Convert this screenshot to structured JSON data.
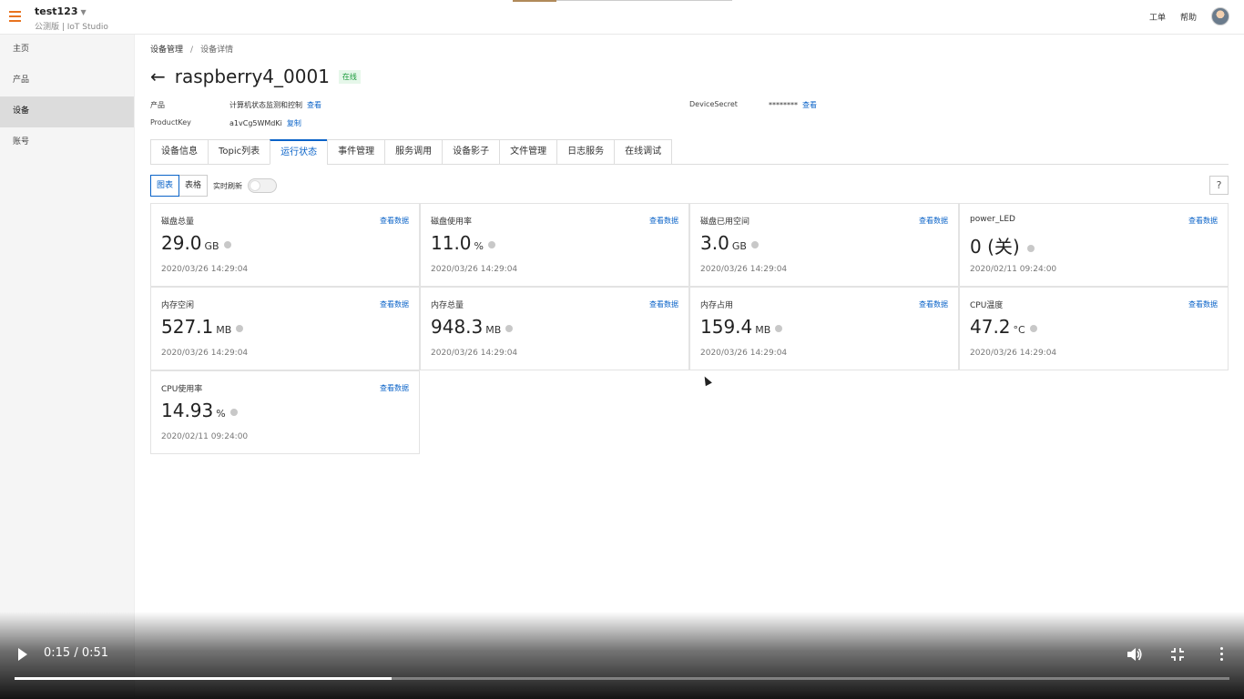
{
  "header": {
    "account": "test123",
    "subtitle": "公测版 | IoT Studio",
    "links": [
      "工单",
      "帮助"
    ]
  },
  "sidebar": {
    "items": [
      {
        "label": "主页"
      },
      {
        "label": "产品"
      },
      {
        "label": "设备"
      },
      {
        "label": "账号"
      }
    ],
    "active_index": 2
  },
  "breadcrumb": {
    "parent": "设备管理",
    "separator": "/",
    "current": "设备详情"
  },
  "device": {
    "name": "raspberry4_0001",
    "status": "在线",
    "product_label": "产品",
    "product_value": "计算机状态监测和控制",
    "product_link": "查看",
    "productkey_label": "ProductKey",
    "productkey_value": "a1vCg5WMdKi",
    "productkey_link": "复制",
    "secret_label": "DeviceSecret",
    "secret_value": "********",
    "secret_link": "查看"
  },
  "tabs": [
    "设备信息",
    "Topic列表",
    "运行状态",
    "事件管理",
    "服务调用",
    "设备影子",
    "文件管理",
    "日志服务",
    "在线调试"
  ],
  "active_tab": 2,
  "toolbar": {
    "view_chart": "图表",
    "view_table": "表格",
    "realtime_label": "实时刷新",
    "realtime_on": false,
    "help": "?"
  },
  "cards": [
    {
      "name": "磁盘总量",
      "value": "29.0",
      "unit": "GB",
      "time": "2020/03/26 14:29:04",
      "link": "查看数据"
    },
    {
      "name": "磁盘使用率",
      "value": "11.0",
      "unit": "%",
      "time": "2020/03/26 14:29:04",
      "link": "查看数据"
    },
    {
      "name": "磁盘已用空间",
      "value": "3.0",
      "unit": "GB",
      "time": "2020/03/26 14:29:04",
      "link": "查看数据"
    },
    {
      "name": "power_LED",
      "value": "0 (关)",
      "unit": "",
      "time": "2020/02/11 09:24:00",
      "link": "查看数据"
    },
    {
      "name": "内存空闲",
      "value": "527.1",
      "unit": "MB",
      "time": "2020/03/26 14:29:04",
      "link": "查看数据"
    },
    {
      "name": "内存总量",
      "value": "948.3",
      "unit": "MB",
      "time": "2020/03/26 14:29:04",
      "link": "查看数据"
    },
    {
      "name": "内存占用",
      "value": "159.4",
      "unit": "MB",
      "time": "2020/03/26 14:29:04",
      "link": "查看数据"
    },
    {
      "name": "CPU温度",
      "value": "47.2",
      "unit": "°C",
      "time": "2020/03/26 14:29:04",
      "link": "查看数据"
    },
    {
      "name": "CPU使用率",
      "value": "14.93",
      "unit": "%",
      "time": "2020/02/11 09:24:00",
      "link": "查看数据"
    }
  ],
  "video": {
    "time": "0:15 / 0:51",
    "progress_fraction": 0.31
  },
  "colors": {
    "accent": "#0a63c8",
    "brand_orange": "#e8731f",
    "status_green": "#1a9a3a"
  }
}
